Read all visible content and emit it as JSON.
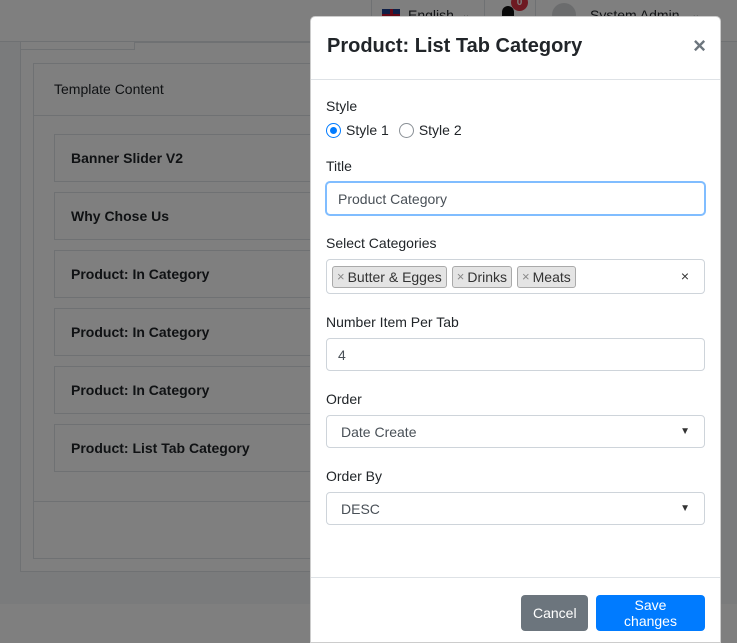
{
  "topbar": {
    "language": "English",
    "notifications_count": "0",
    "user_name": "System Admin"
  },
  "template": {
    "header": "Template Content",
    "items": [
      "Banner Slider V2",
      "Why Chose Us",
      "Product: In Category",
      "Product: In Category",
      "Product: In Category",
      "Product: List Tab Category"
    ]
  },
  "modal": {
    "title": "Product: List Tab Category",
    "style": {
      "label": "Style",
      "options": [
        "Style 1",
        "Style 2"
      ],
      "selected": "Style 1"
    },
    "title_field": {
      "label": "Title",
      "value": "Product Category"
    },
    "categories": {
      "label": "Select Categories",
      "tags": [
        "Butter & Egges",
        "Drinks",
        "Meats"
      ],
      "clear_symbol": "×"
    },
    "number_item": {
      "label": "Number Item Per Tab",
      "value": "4"
    },
    "order": {
      "label": "Order",
      "value": "Date Create"
    },
    "order_by": {
      "label": "Order By",
      "value": "DESC"
    },
    "buttons": {
      "cancel": "Cancel",
      "save": "Save changes"
    },
    "close_symbol": "×"
  },
  "colors": {
    "primary": "#007bff",
    "secondary": "#6c757d"
  }
}
